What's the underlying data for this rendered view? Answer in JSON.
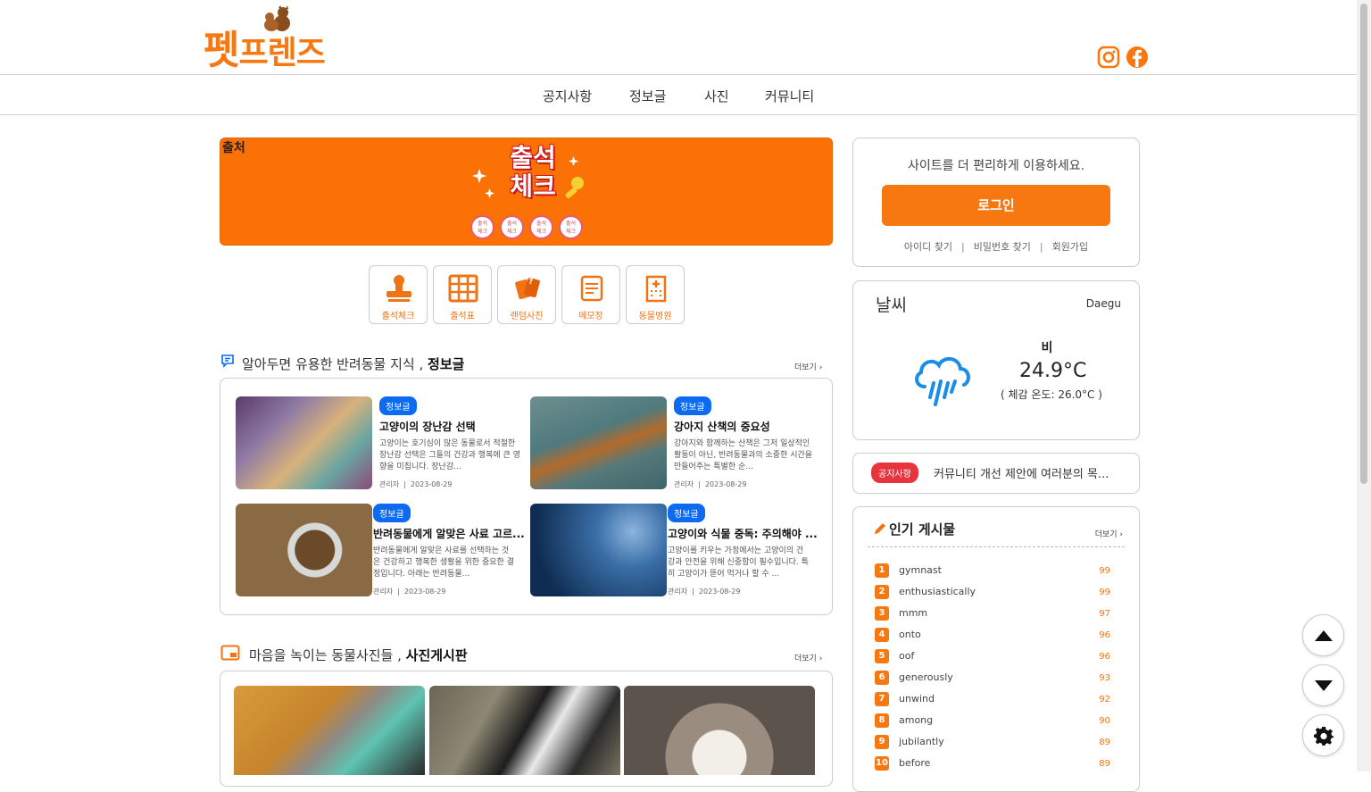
{
  "header": {
    "logo_main": "펫",
    "logo_sub": "프렌즈",
    "sns": [
      "instagram-icon",
      "facebook-icon"
    ]
  },
  "nav": {
    "items": [
      "공지사항",
      "정보글",
      "사진",
      "커뮤니티"
    ]
  },
  "banner": {
    "source_label": "출처",
    "title_line1": "출석",
    "title_line2": "체크",
    "stamp_text": "출석\n체크"
  },
  "quick_menu": [
    {
      "label": "출석체크",
      "icon": "stamp-icon"
    },
    {
      "label": "출석표",
      "icon": "calendar-grid-icon"
    },
    {
      "label": "랜덤사진",
      "icon": "cards-icon"
    },
    {
      "label": "메모장",
      "icon": "memo-icon"
    },
    {
      "label": "동물병원",
      "icon": "hospital-icon"
    }
  ],
  "info_section": {
    "title_prefix": "알아두면 유용한 반려동물 지식 , ",
    "title_strong": "정보글",
    "more": "더보기 ›",
    "posts": [
      {
        "badge": "정보글",
        "title": "고양이의 장난감 선택",
        "desc": "고양이는 호기심이 많은 동물로서 적절한 장난감 선택은 그들의 건강과 행복에 큰 영향을 미칩니다. 장난감...",
        "author": "관리자",
        "date": "2023-08-29"
      },
      {
        "badge": "정보글",
        "title": "강아지 산책의 중요성",
        "desc": "강아지와 함께하는 산책은 그저 일상적인 활동이 아닌, 반려동물과의 소중한 시간을 만들어주는 특별한 순...",
        "author": "관리자",
        "date": "2023-08-29"
      },
      {
        "badge": "정보글",
        "title": "반려동물에게 알맞은 사료 고르...",
        "desc": "반려동물에게 알맞은 사료를 선택하는 것은 건강하고 행복한 생활을 위한 중요한 결정입니다. 아래는 반려동물...",
        "author": "관리자",
        "date": "2023-08-29"
      },
      {
        "badge": "정보글",
        "title": "고양이와 식물 중독: 주의해야 ...",
        "desc": "고양이를 키우는 가정에서는 고양이의 건강과 안전을 위해 신중함이 필수입니다. 특히 고양이가 뜯어 먹거나 할 수 ...",
        "author": "관리자",
        "date": "2023-08-29"
      }
    ]
  },
  "photo_section": {
    "title_prefix": "마음을 녹이는 동물사진들 , ",
    "title_strong": "사진게시판",
    "more": "더보기 ›"
  },
  "login": {
    "message": "사이트를 더 편리하게 이용하세요.",
    "button": "로그인",
    "links": [
      "아이디 찾기",
      "비밀번호 찾기",
      "회원가입"
    ],
    "sep": "|"
  },
  "weather": {
    "title": "날씨",
    "city": "Daegu",
    "condition": "비",
    "temp": "24.9°C",
    "feels": "( 체감 온도: 26.0°C )"
  },
  "notice": {
    "badge": "공지사항",
    "text": "커뮤니티 개선 제안에 여러분의 목..."
  },
  "popular": {
    "title": "인기 게시물",
    "more": "더보기 ›",
    "items": [
      {
        "rank": "1",
        "name": "gymnast",
        "count": "99"
      },
      {
        "rank": "2",
        "name": "enthusiastically",
        "count": "99"
      },
      {
        "rank": "3",
        "name": "mmm",
        "count": "97"
      },
      {
        "rank": "4",
        "name": "onto",
        "count": "96"
      },
      {
        "rank": "5",
        "name": "oof",
        "count": "96"
      },
      {
        "rank": "6",
        "name": "generously",
        "count": "93"
      },
      {
        "rank": "7",
        "name": "unwind",
        "count": "92"
      },
      {
        "rank": "8",
        "name": "among",
        "count": "90"
      },
      {
        "rank": "9",
        "name": "jubilantly",
        "count": "89"
      },
      {
        "rank": "10",
        "name": "before",
        "count": "89"
      }
    ]
  },
  "colors": {
    "accent": "#f77811",
    "badge_blue": "#0c6bf0",
    "notice_red": "#e8343f"
  }
}
